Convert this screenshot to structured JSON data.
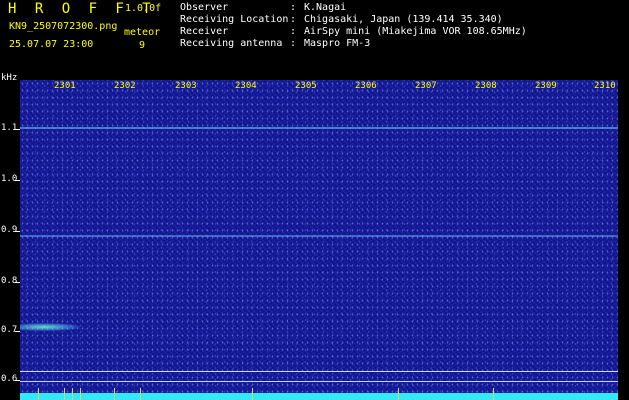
{
  "header": {
    "app_title": "H R O F F T",
    "version": "1.0.0f",
    "filename": "KN9_2507072300.png",
    "meteor_label": "meteor",
    "datetime": "25.07.07 23:00",
    "meteor_count": "9"
  },
  "info": [
    {
      "key": "Observer",
      "sep": ":",
      "value": "K.Nagai"
    },
    {
      "key": "Receiving Location",
      "sep": ":",
      "value": "Chigasaki, Japan (139.414 35.340)"
    },
    {
      "key": "Receiver",
      "sep": ":",
      "value": "AirSpy mini (Miakejima VOR 108.65MHz)"
    },
    {
      "key": "Receiving antenna",
      "sep": ":",
      "value": "Maspro FM-3"
    }
  ],
  "axis": {
    "y_unit": "kHz",
    "y_ticks": [
      "1.1",
      "1.0",
      "0.9",
      "0.8",
      "0.7",
      "0.6"
    ],
    "x_ticks": [
      "2301",
      "2302",
      "2303",
      "2304",
      "2305",
      "2306",
      "2307",
      "2308",
      "2309",
      "2310"
    ]
  },
  "colors": {
    "background": "#000000",
    "label_yellow": "#ffff00",
    "plot_blue": "#12148a",
    "band_cyan": "#35e8f5"
  }
}
